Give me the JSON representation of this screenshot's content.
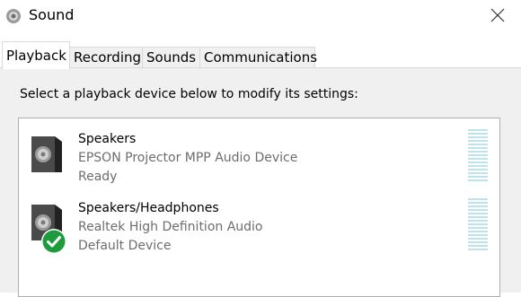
{
  "window": {
    "title": "Sound",
    "icon": "speaker-icon",
    "close_icon": "close-icon"
  },
  "tabs": [
    {
      "label": "Playback",
      "active": true
    },
    {
      "label": "Recording",
      "active": false
    },
    {
      "label": "Sounds",
      "active": false
    },
    {
      "label": "Communications",
      "active": false
    }
  ],
  "playback": {
    "instruction": "Select a playback device below to modify its settings:",
    "devices": [
      {
        "name": "Speakers",
        "description": "EPSON Projector MPP Audio Device",
        "status": "Ready",
        "icon": "speaker-icon",
        "is_default": false
      },
      {
        "name": "Speakers/Headphones",
        "description": "Realtek High Definition Audio",
        "status": "Default Device",
        "icon": "speaker-icon",
        "badge_icon": "green-checkmark-icon",
        "is_default": true
      }
    ]
  },
  "colors": {
    "level_meter": "#bfe3ec",
    "default_badge": "#1e9b3d"
  }
}
